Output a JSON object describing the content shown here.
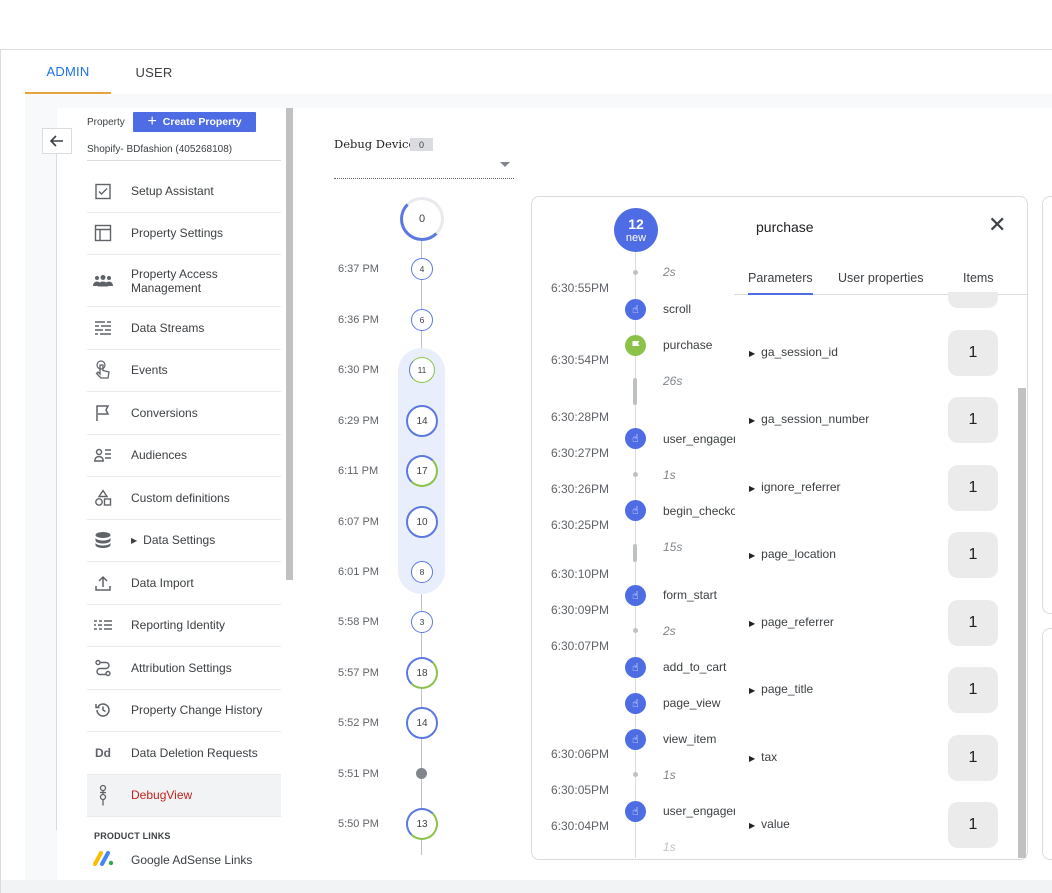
{
  "tabs": [
    {
      "label": "ADMIN",
      "active": true
    },
    {
      "label": "USER",
      "active": false
    }
  ],
  "property": {
    "label": "Property",
    "create_label": "Create Property",
    "name": "Shopify- BDfashion (405268108)"
  },
  "nav": {
    "items": [
      {
        "label": "Setup Assistant",
        "icon": "checklist-icon"
      },
      {
        "label": "Property Settings",
        "icon": "window-icon"
      },
      {
        "label": "Property Access Management",
        "icon": "people-icon"
      },
      {
        "label": "Data Streams",
        "icon": "streams-icon"
      },
      {
        "label": "Events",
        "icon": "touch-icon"
      },
      {
        "label": "Conversions",
        "icon": "flag-icon"
      },
      {
        "label": "Audiences",
        "icon": "audience-icon"
      },
      {
        "label": "Custom definitions",
        "icon": "shapes-icon"
      },
      {
        "label": "Data Settings",
        "icon": "database-icon"
      },
      {
        "label": "Data Import",
        "icon": "upload-icon"
      },
      {
        "label": "Reporting Identity",
        "icon": "identity-icon"
      },
      {
        "label": "Attribution Settings",
        "icon": "attribution-icon"
      },
      {
        "label": "Property Change History",
        "icon": "history-icon"
      },
      {
        "label": "Data Deletion Requests",
        "icon": "dd-icon"
      },
      {
        "label": "DebugView",
        "icon": "debug-icon"
      }
    ],
    "product_links_heading": "PRODUCT LINKS",
    "adsense_label": "Google AdSense Links"
  },
  "debug_device": {
    "label": "Debug Device",
    "count": "0"
  },
  "minutes": {
    "top_count": "0",
    "rows": [
      {
        "time": "6:37 PM",
        "count": "4"
      },
      {
        "time": "6:36 PM",
        "count": "6"
      },
      {
        "time": "6:30 PM",
        "count": "11"
      },
      {
        "time": "6:29 PM",
        "count": "14"
      },
      {
        "time": "6:11 PM",
        "count": "17"
      },
      {
        "time": "6:07 PM",
        "count": "10"
      },
      {
        "time": "6:01 PM",
        "count": "8"
      },
      {
        "time": "5:58 PM",
        "count": "3"
      },
      {
        "time": "5:57 PM",
        "count": "18"
      },
      {
        "time": "5:52 PM",
        "count": "14"
      },
      {
        "time": "5:51 PM",
        "count": ""
      },
      {
        "time": "5:50 PM",
        "count": "13"
      }
    ]
  },
  "seconds": {
    "new_count": "12",
    "new_label": "new",
    "times": [
      "6:30:55PM",
      "6:30:54PM",
      "6:30:28PM",
      "6:30:27PM",
      "6:30:26PM",
      "6:30:25PM",
      "6:30:10PM",
      "6:30:09PM",
      "6:30:07PM",
      "6:30:06PM",
      "6:30:05PM",
      "6:30:04PM"
    ],
    "gaps": [
      "2s",
      "26s",
      "1s",
      "15s",
      "2s",
      "1s",
      "1s"
    ],
    "events": [
      "scroll",
      "purchase",
      "user_engagement",
      "begin_checkout",
      "form_start",
      "add_to_cart",
      "page_view",
      "view_item",
      "user_engagement"
    ]
  },
  "detail": {
    "event_title": "purchase",
    "tabs": [
      "Parameters",
      "User properties",
      "Items"
    ],
    "params": [
      {
        "name": "ga_session_id",
        "value": "1"
      },
      {
        "name": "ga_session_number",
        "value": "1"
      },
      {
        "name": "ignore_referrer",
        "value": "1"
      },
      {
        "name": "page_location",
        "value": "1"
      },
      {
        "name": "page_referrer",
        "value": "1"
      },
      {
        "name": "page_title",
        "value": "1"
      },
      {
        "name": "tax",
        "value": "1"
      },
      {
        "name": "value",
        "value": "1"
      }
    ]
  },
  "colors": {
    "accent": "#4e6ce3",
    "conversion": "#8bc34a",
    "active_nav": "#c5221f"
  }
}
